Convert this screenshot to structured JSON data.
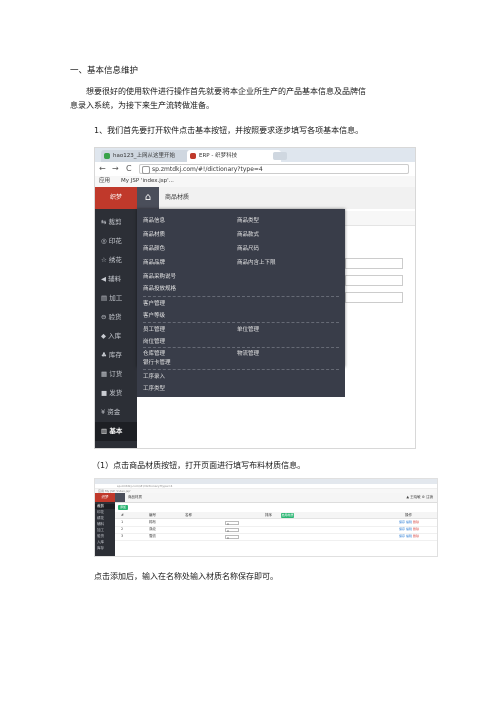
{
  "doc": {
    "heading": "一、基本信息维护",
    "para_line1": "想要很好的使用软件进行操作首先就要将本企业所生产的产品基本信息及品牌信",
    "para_line2": "息录入系统，为接下来生产流转做准备。",
    "step1": "1、我们首先要打开软件点击基本按钮，并按照要求逐步填写各项基本信息。",
    "step1_sub": "（1）点击商品材质按钮，打开页面进行填写布料材质信息。",
    "step1_note": "点击添加后，输入在名称处输入材质名称保存即可。"
  },
  "screenshot1": {
    "tabs": [
      "hao123_上网从这里开始",
      "ERP - 织梦科技"
    ],
    "nav": {
      "back": "←",
      "forward": "→",
      "reload": "C"
    },
    "url": "sp.zmtdkj.com/#!/dictionary?type=4",
    "bookmarks": [
      "应用",
      "My JSP 'index.jsp'..."
    ],
    "brand": "织梦",
    "breadcrumb": "商品材质",
    "sidebar": [
      {
        "icon": "⇆",
        "label": "裁剪"
      },
      {
        "icon": "◎",
        "label": "印花"
      },
      {
        "icon": "☆",
        "label": "绣花"
      },
      {
        "icon": "◀",
        "label": "辅料"
      },
      {
        "icon": "▤",
        "label": "加工"
      },
      {
        "icon": "⊖",
        "label": "验货"
      },
      {
        "icon": "◆",
        "label": "入库"
      },
      {
        "icon": "♣",
        "label": "库存"
      },
      {
        "icon": "▦",
        "label": "订货"
      },
      {
        "icon": "■",
        "label": "发货"
      },
      {
        "icon": "¥",
        "label": "资金"
      },
      {
        "icon": "▥",
        "label": "基本"
      }
    ],
    "menu": {
      "group1_left": [
        "商品信息",
        "商品材质",
        "商品颜色",
        "商品品牌",
        "商品采购说号",
        "商品投放规格"
      ],
      "group1_right": [
        "商品类型",
        "商品款式",
        "商品尺码",
        "商品内含上下限"
      ],
      "group2": [
        "客户管理",
        "客户等级"
      ],
      "group3_left": [
        "员工管理",
        "岗位管理"
      ],
      "group3_right": [
        "单位管理"
      ],
      "group4_left": [
        "仓库管理",
        "银行卡管理"
      ],
      "group4_right": [
        "物流管理"
      ],
      "group5": [
        "工序录入",
        "工序类型"
      ]
    }
  },
  "screenshot2": {
    "url": "sp.zmtdkj.com/#!/dictionary?type=4",
    "bookmarks": "应用 My JSP 'index.jsp'",
    "brand": "织梦",
    "breadcrumb": "商品材质",
    "header_right": "▲ 王晓敏 ⚙ 注销",
    "sidebar": [
      "裁剪",
      "印花",
      "绣花",
      "辅料",
      "加工",
      "验货",
      "入库",
      "库存"
    ],
    "add_button": "添加",
    "columns": [
      "#",
      "编号",
      "名称",
      "排序",
      "启用材质",
      "操作"
    ],
    "rows": [
      {
        "idx": "1",
        "code": "棉布",
        "sort": "0",
        "op_save": "保存",
        "op_edit": "编辑",
        "op_del": "删除"
      },
      {
        "idx": "2",
        "code": "涤纶",
        "sort": "0",
        "op_save": "保存",
        "op_edit": "编辑",
        "op_del": "删除"
      },
      {
        "idx": "3",
        "code": "雪纺",
        "sort": "0",
        "op_save": "保存",
        "op_edit": "编辑",
        "op_del": "删除"
      }
    ]
  },
  "colors": {
    "brand_red": "#c0392b",
    "dark_nav": "#393d49",
    "green": "#2bb673"
  }
}
